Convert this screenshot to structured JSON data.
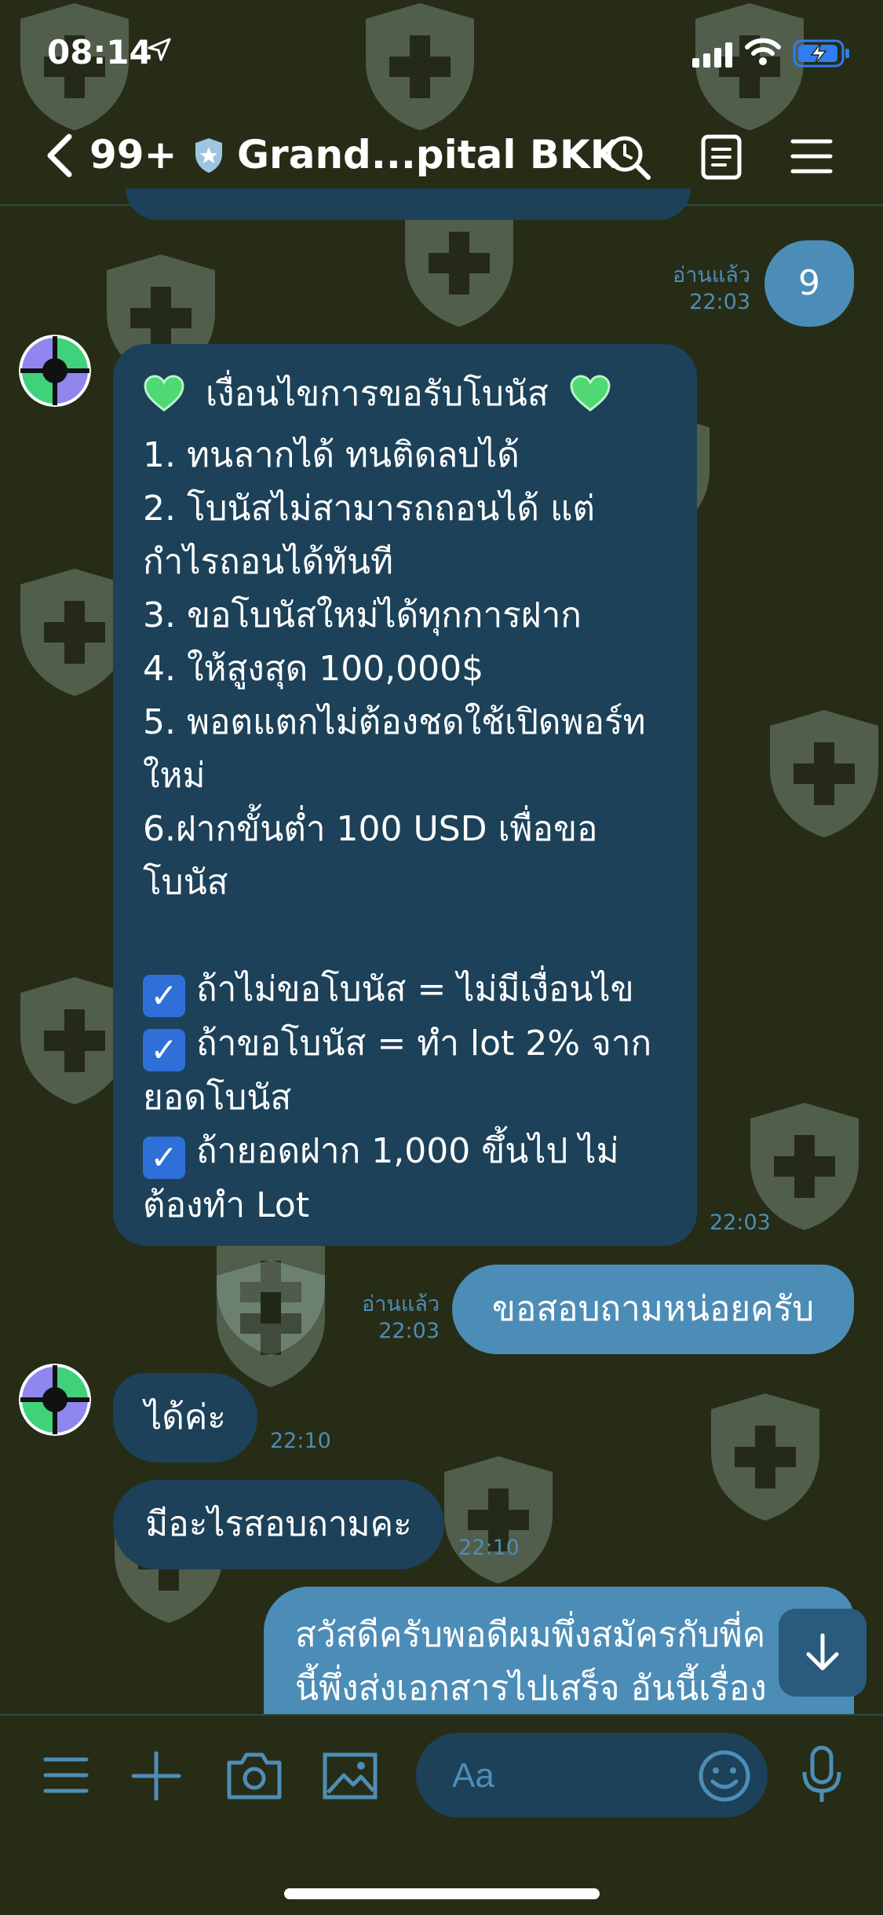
{
  "status_bar": {
    "time": "08:14",
    "location_icon": "location-arrow-icon",
    "signal_icon": "signal-icon",
    "wifi_icon": "wifi-icon",
    "battery_icon": "battery-charging-icon"
  },
  "header": {
    "back_icon": "chevron-left-icon",
    "unread_count": "99+",
    "verified_icon": "shield-star-icon",
    "title": "Grand...pital BKK",
    "search_icon": "search-icon",
    "notes_icon": "notes-icon",
    "menu_icon": "menu-icon"
  },
  "messages": {
    "m1": {
      "text": "9",
      "read": "อ่านแล้ว",
      "time": "22:03"
    },
    "m2": {
      "title": "เงื่อนไขการขอรับโบนัส",
      "lines": [
        "1. ทนลากได้ ทนติดลบได้",
        "2. โบนัสไม่สามารถถอนได้ แต่",
        "กำไรถอนได้ทันที",
        "3. ขอโบนัสใหม่ได้ทุกการฝาก",
        "4. ให้สูงสุด 100,000$",
        "5. พอตแตกไม่ต้องชดใช้เปิดพอร์ท",
        "ใหม่",
        "6.ฝากขั้นต่ำ 100 USD เพื่อขอ",
        "โบนัส"
      ],
      "check1": "ถ้าไม่ขอโบนัส = ไม่มีเงื่อนไข",
      "check2a": "ถ้าขอโบนัส = ทำ lot 2% จาก",
      "check2b": "ยอดโบนัส",
      "check3a": "ถ้ายอดฝาก 1,000 ขึ้นไป ไม่",
      "check3b": "ต้องทำ Lot",
      "time": "22:03"
    },
    "m3": {
      "text": "ขอสอบถามหน่อยครับ",
      "read": "อ่านแล้ว",
      "time": "22:03"
    },
    "m4": {
      "text": "ได้ค่ะ",
      "time": "22:10"
    },
    "m5": {
      "text": "มีอะไรสอบถามคะ",
      "time": "22:10"
    },
    "m6": {
      "line1": "สวัสดีครับพอดีผมพึ่งสมัครกับพี่ค",
      "line2": "นี้พึ่งส่งเอกสารไปเสร็จ อันนี้เรื่อง"
    }
  },
  "input": {
    "placeholder": "Aa"
  },
  "toolbar": {
    "icons": [
      "menu-icon",
      "plus-icon",
      "camera-icon",
      "image-icon",
      "emoji-icon",
      "microphone-icon"
    ]
  },
  "colors": {
    "background": "#262c16",
    "incoming_bubble": "#1c4159",
    "outgoing_bubble": "#4c8db7",
    "meta_text": "#4e8db6"
  }
}
